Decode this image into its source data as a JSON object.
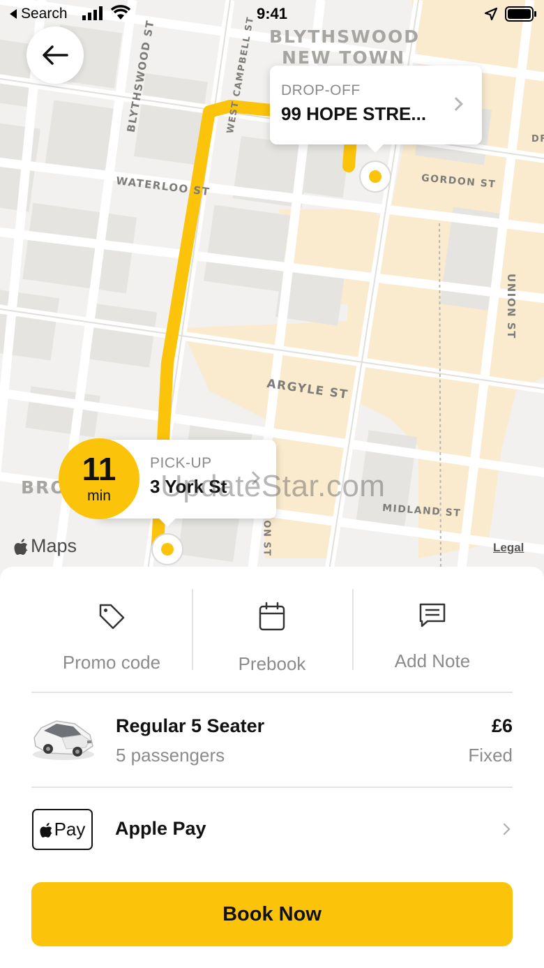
{
  "status_bar": {
    "back_app": "Search",
    "time": "9:41"
  },
  "map": {
    "district": [
      "BLYTHSWOOD",
      "NEW TOWN"
    ],
    "district_partial": "BROO",
    "streets": {
      "blythswood": "BLYTHSWOOD ST",
      "west_campbell": "WEST CAMPBELL ST",
      "waterloo": "WATERLOO ST",
      "gordon": "GORDON ST",
      "union": "UNION ST",
      "argyle": "ARGYLE ST",
      "midland": "MIDLAND ST",
      "york_partial": "ON ST",
      "partial_right": "DF"
    },
    "route_color": "#fcc30b",
    "attribution": "Maps",
    "legal": "Legal"
  },
  "dropoff": {
    "label": "DROP-OFF",
    "address": "99 HOPE STRE..."
  },
  "pickup": {
    "label": "PICK-UP",
    "address": "3 York St",
    "eta_value": "11",
    "eta_unit": "min"
  },
  "watermark": "UpdateStar.com",
  "actions": [
    {
      "label": "Promo code",
      "icon": "tag-icon"
    },
    {
      "label": "Prebook",
      "icon": "calendar-icon"
    },
    {
      "label": "Add Note",
      "icon": "note-icon"
    }
  ],
  "vehicle": {
    "name": "Regular 5 Seater",
    "capacity": "5 passengers",
    "price": "£6",
    "price_type": "Fixed"
  },
  "payment": {
    "badge": "Pay",
    "method": "Apple Pay"
  },
  "book_button": "Book Now",
  "colors": {
    "accent": "#fcc30b",
    "map_bg": "#f2f1ef",
    "map_highlight": "#faebcf"
  }
}
